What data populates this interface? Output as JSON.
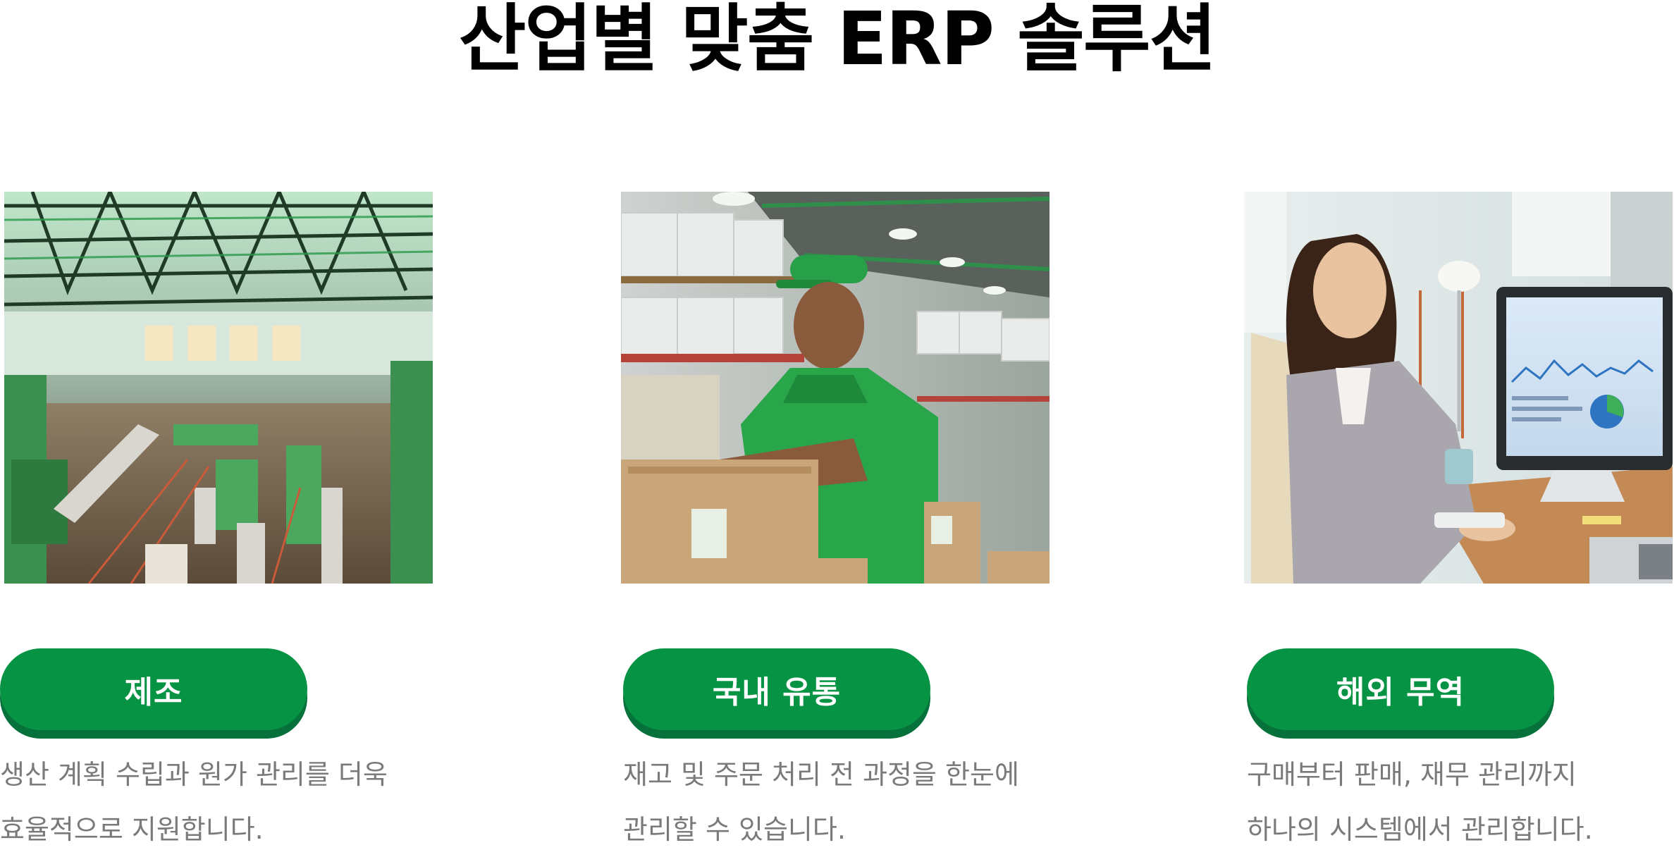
{
  "title": "산업별 맞춤 ERP 솔루션",
  "cards": [
    {
      "image": "factory-floor-photo",
      "label": "제조",
      "desc_line1": "생산 계획 수립과 원가 관리를 더욱",
      "desc_line2": "효율적으로 지원합니다."
    },
    {
      "image": "warehouse-worker-photo",
      "label": "국내 유통",
      "desc_line1": "재고 및 주문 처리 전 과정을 한눈에",
      "desc_line2": "관리할 수 있습니다."
    },
    {
      "image": "office-worker-photo",
      "label": "해외 무역",
      "desc_line1": "구매부터 판매, 재무 관리까지",
      "desc_line2": "하나의 시스템에서 관리합니다."
    }
  ],
  "colors": {
    "accent": "#079344",
    "accent_shadow": "#06713a",
    "text_muted": "#7a7a7a",
    "title": "#000000"
  }
}
